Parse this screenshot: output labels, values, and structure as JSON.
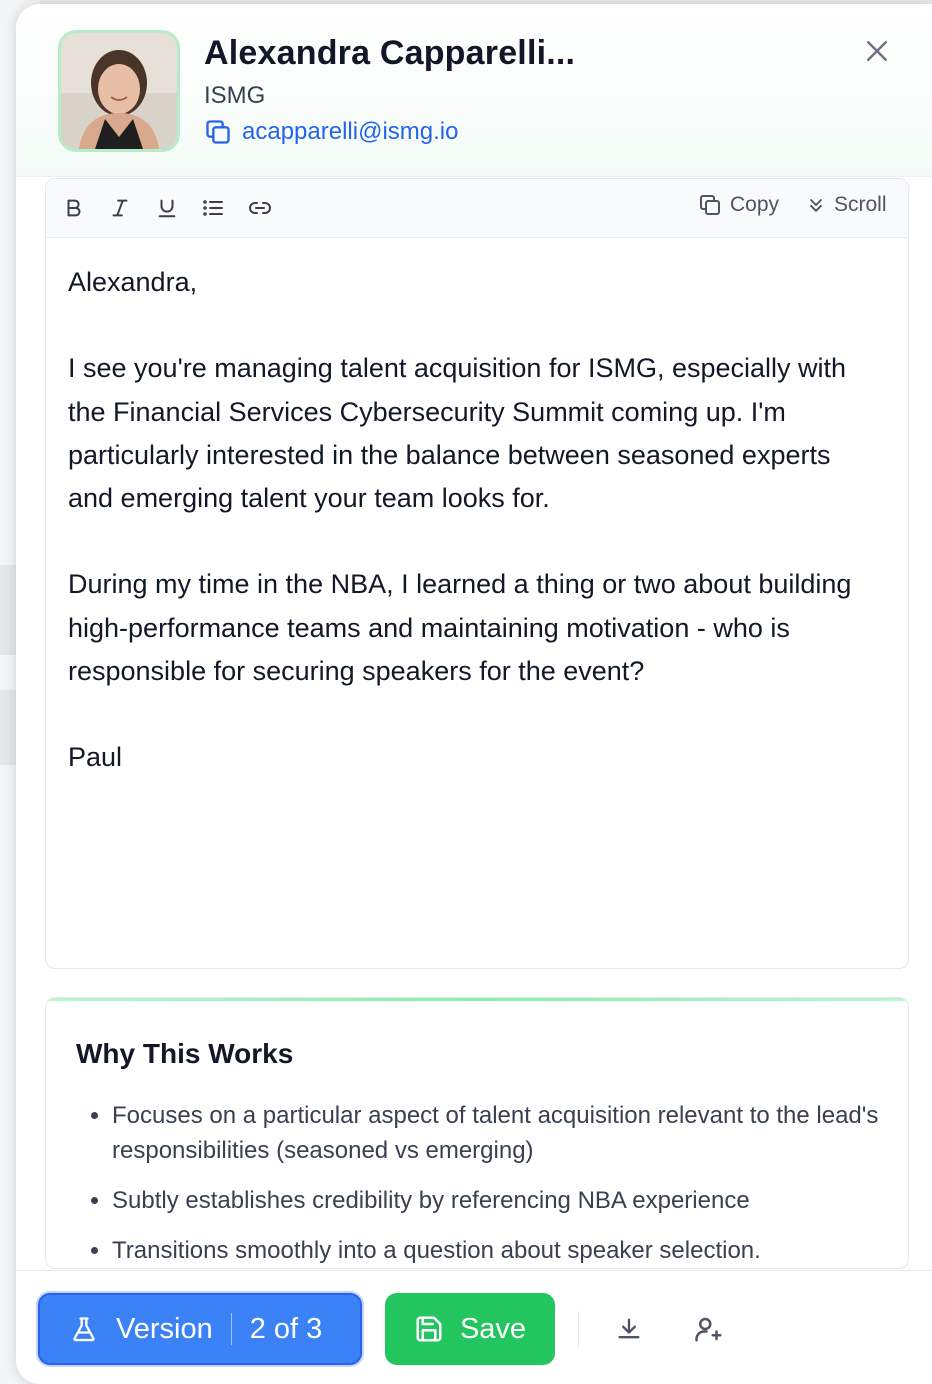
{
  "contact": {
    "name": "Alexandra Capparelli...",
    "company": "ISMG",
    "email": "acapparelli@ismg.io"
  },
  "toolbar": {
    "bold_icon": "bold-icon",
    "italic_icon": "italic-icon",
    "underline_icon": "underline-icon",
    "list_icon": "list-icon",
    "link_icon": "link-icon",
    "copy_label": "Copy",
    "scroll_label": "Scroll"
  },
  "message": {
    "paragraphs": [
      "Alexandra,",
      "I see you're managing talent acquisition for ISMG, especially with the Financial Services Cybersecurity Summit coming up. I'm particularly interested in the balance between seasoned experts and emerging talent your team looks for.",
      "During my time in the NBA, I learned a thing or two about building high-performance teams and maintaining motivation - who is responsible for securing speakers for the event?",
      "Paul"
    ]
  },
  "why": {
    "title": "Why This Works",
    "items": [
      "Focuses on a particular aspect of talent acquisition relevant to the lead's responsibilities (seasoned vs emerging)",
      "Subtly establishes credibility by referencing NBA experience",
      "Transitions smoothly into a question about speaker selection."
    ]
  },
  "footer": {
    "version_label": "Version",
    "version_count": "2 of 3",
    "save_label": "Save"
  },
  "colors": {
    "primary_blue": "#3b82f6",
    "save_green": "#22c55e",
    "link_blue": "#2563eb"
  }
}
